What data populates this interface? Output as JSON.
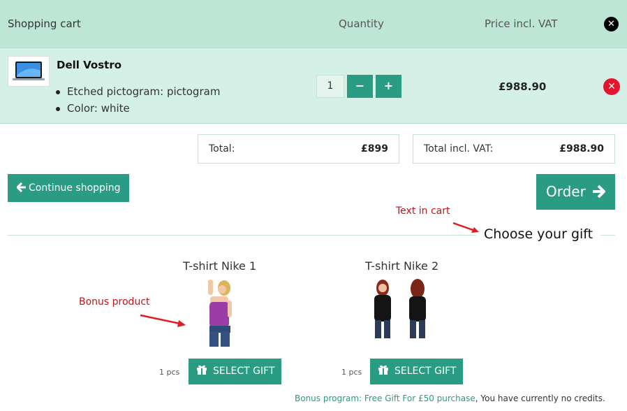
{
  "header": {
    "title": "Shopping cart",
    "quantity_col": "Quantity",
    "price_col": "Price incl. VAT",
    "close_icon": "close-icon"
  },
  "item": {
    "name": "Dell Vostro",
    "options": [
      "Etched pictogram: pictogram",
      "Color: white"
    ],
    "quantity": "1",
    "minus_label": "−",
    "plus_label": "+",
    "price": "£988.90",
    "remove_icon": "remove-icon"
  },
  "totals": {
    "total_label": "Total:",
    "total_value": "£899",
    "total_vat_label": "Total incl. VAT:",
    "total_vat_value": "£988.90"
  },
  "buttons": {
    "continue": "Continue shopping",
    "order": "Order"
  },
  "gifts": {
    "heading": "Choose your gift",
    "items": [
      {
        "name": "T-shirt Nike 1",
        "pcs": "1 pcs",
        "button": "SELECT GIFT"
      },
      {
        "name": "T-shirt Nike 2",
        "pcs": "1 pcs",
        "button": "SELECT GIFT"
      }
    ]
  },
  "annotations": {
    "text_in_cart": "Text in cart",
    "bonus_product": "Bonus product"
  },
  "bonus": {
    "link": "Bonus program: Free Gift For £50 purchase",
    "rest": ", You have currently no credits."
  },
  "colors": {
    "accent": "#2a9c84",
    "header_bg": "#bde6d6",
    "row_bg": "#d5f0e6",
    "remove": "#e4152a",
    "annotation": "#c0151b"
  }
}
